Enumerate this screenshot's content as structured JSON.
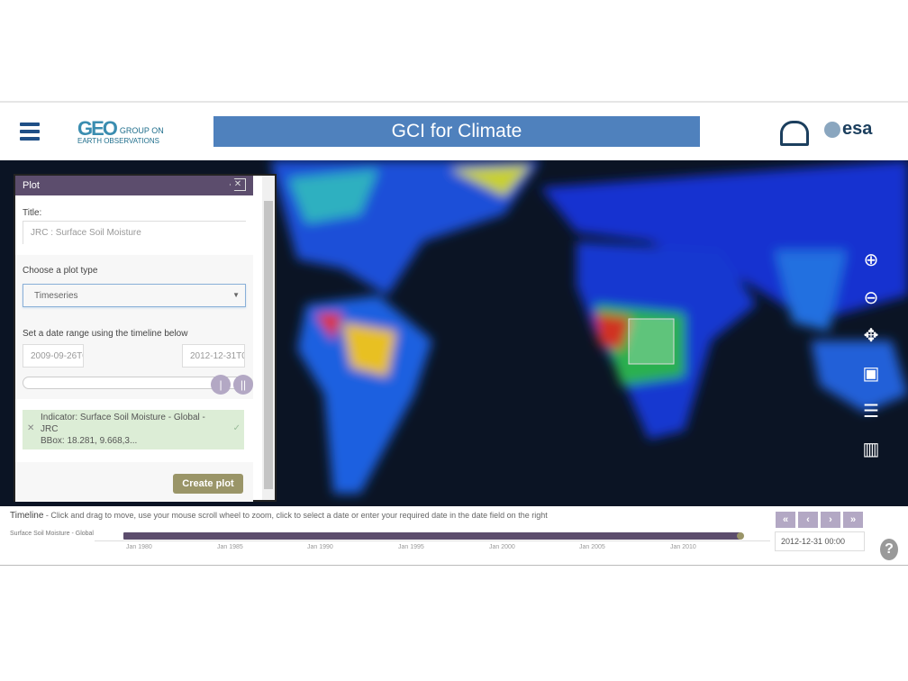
{
  "header": {
    "geo_logo_big": "GEO",
    "geo_logo_line1": "GROUP ON",
    "geo_logo_line2": "EARTH OBSERVATIONS",
    "title": "GCI for Climate",
    "esa_logo": "esa"
  },
  "plot_panel": {
    "heading": "Plot",
    "title_label": "Title:",
    "title_value": "JRC : Surface Soil Moisture",
    "plot_type_label": "Choose a plot type",
    "plot_type_value": "Timeseries",
    "date_range_label": "Set a date range using the timeline below",
    "date_start": "2009-09-26T0",
    "date_end": "2012-12-31T0",
    "indicator_line1": "Indicator: Surface Soil Moisture - Global -",
    "indicator_line2": "JRC",
    "indicator_bbox": "BBox: 18.281, 9.668,3...",
    "create_button": "Create plot"
  },
  "map_tools": [
    "zoom-in-icon",
    "zoom-out-icon",
    "pan-icon",
    "select-area-icon",
    "layers-icon",
    "map-icon"
  ],
  "timeline": {
    "title": "Timeline",
    "instructions": " - Click and drag to move, use your mouse scroll wheel to zoom, click to select a date or enter your required date in the date field on the right",
    "layer": "Surface Soil Moisture - Global",
    "ticks": [
      "Jan 1980",
      "Jan 1985",
      "Jan 1990",
      "Jan 1995",
      "Jan 2000",
      "Jan 2005",
      "Jan 2010"
    ],
    "nav": [
      "«",
      "‹",
      "›",
      "»"
    ],
    "current_date": "2012-12-31 00:00",
    "help": "?"
  },
  "colors": {
    "title_bar": "#4f81bd",
    "panel_header": "#5c4d6d",
    "create_button": "#9a9568",
    "indicator_bg": "#dcedd6"
  }
}
